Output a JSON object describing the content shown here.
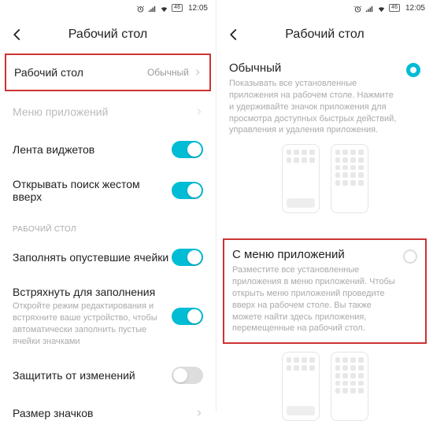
{
  "status": {
    "time": "12:05"
  },
  "left": {
    "title": "Рабочий стол",
    "rows": {
      "home_label": "Рабочий стол",
      "home_value": "Обычный",
      "app_menu": "Меню приложений",
      "widget_feed": "Лента виджетов",
      "swipe_search": "Открывать поиск жестом вверх",
      "section": "РАБОЧИЙ СТОЛ",
      "fill_empty": "Заполнять опустевшие ячейки",
      "shake_label": "Встряхнуть для заполнения",
      "shake_desc": "Откройте режим редактирования и встряхните ваше устройство, чтобы автоматически заполнить пустые ячейки значками",
      "lock_layout": "Защитить от изменений",
      "icon_size": "Размер значков"
    }
  },
  "right": {
    "title": "Рабочий стол",
    "option1": {
      "title": "Обычный",
      "desc": "Показывать все установленные приложения на рабочем столе. Нажмите и удерживайте значок приложения для просмотра доступных быстрых действий, управления и удаления приложения."
    },
    "option2": {
      "title": "С меню приложений",
      "desc": "Разместите все установленные приложения в меню приложений. Чтобы открыть меню приложений проведите вверх на рабочем столе. Вы также можете найти здесь приложения, перемещенные на рабочий стол."
    }
  }
}
